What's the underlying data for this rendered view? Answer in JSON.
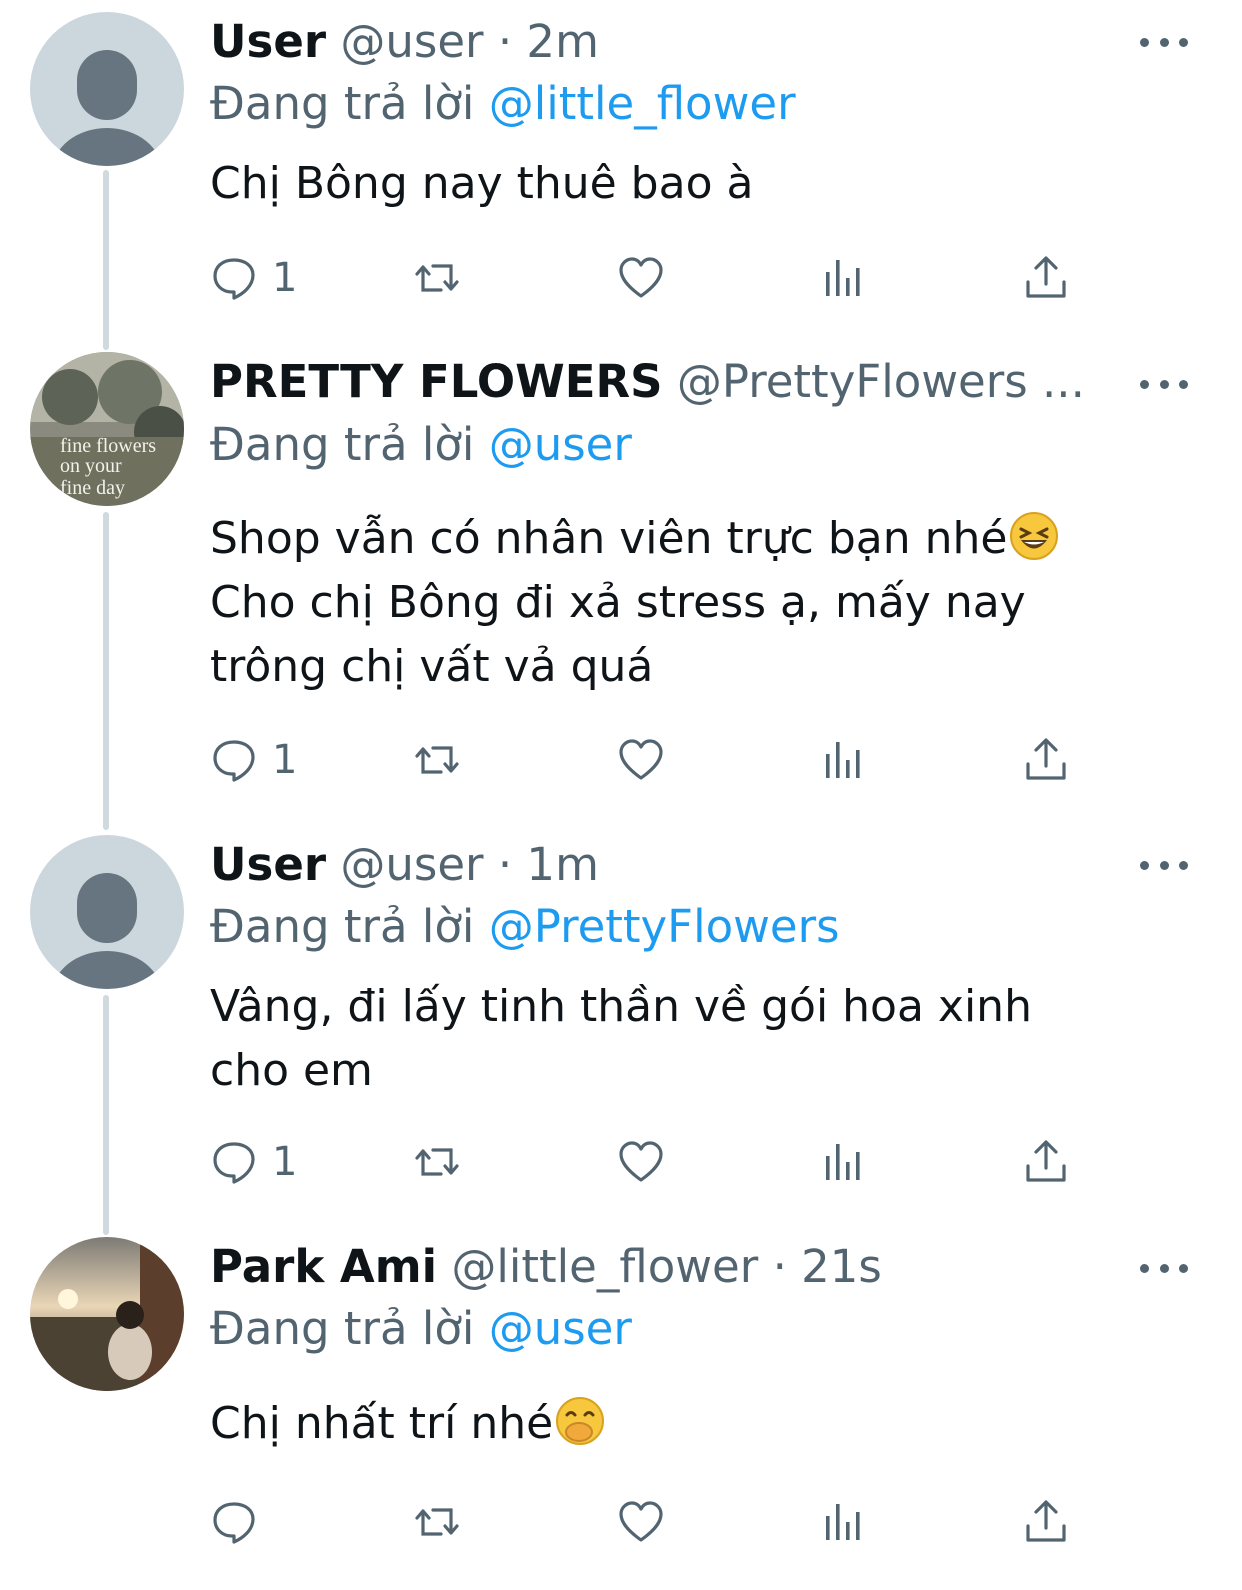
{
  "accent": "#1d9bf0",
  "tweets": [
    {
      "name": "User",
      "handle": "@user",
      "time": "· 2m",
      "reply_prefix": "Đang trả lời",
      "reply_to": "@little_flower",
      "text": "Chị Bông nay thuê bao à",
      "reply_count": "1",
      "avatar": "default-avatar"
    },
    {
      "name": "PRETTY FLOWERS",
      "handle": "@PrettyFlowers ...",
      "time": "",
      "reply_prefix": "Đang trả lời",
      "reply_to": "@user",
      "text_lines": [
        "Shop vẫn có nhân viên trực bạn nhé",
        "Cho chị Bông đi xả stress ạ, mấy nay",
        "trông chị vất vả quá"
      ],
      "emoji": "laughing-emoji",
      "reply_count": "1",
      "avatar": "flower-shop-avatar",
      "avatar_text": [
        "fine flowers",
        "on your",
        "fine day"
      ]
    },
    {
      "name": "User",
      "handle": "@user",
      "time": "· 1m",
      "reply_prefix": "Đang trả lời",
      "reply_to": "@PrettyFlowers",
      "text_lines": [
        "Vâng, đi lấy tinh thần về gói hoa xinh",
        "cho em"
      ],
      "reply_count": "1",
      "avatar": "default-avatar"
    },
    {
      "name": "Park Ami",
      "handle": "@little_flower",
      "time": "· 21s",
      "reply_prefix": "Đang trả lời",
      "reply_to": "@user",
      "text": "Chị nhất trí nhé",
      "emoji": "hand-over-mouth-emoji",
      "reply_count": "",
      "avatar": "photo-avatar"
    }
  ]
}
